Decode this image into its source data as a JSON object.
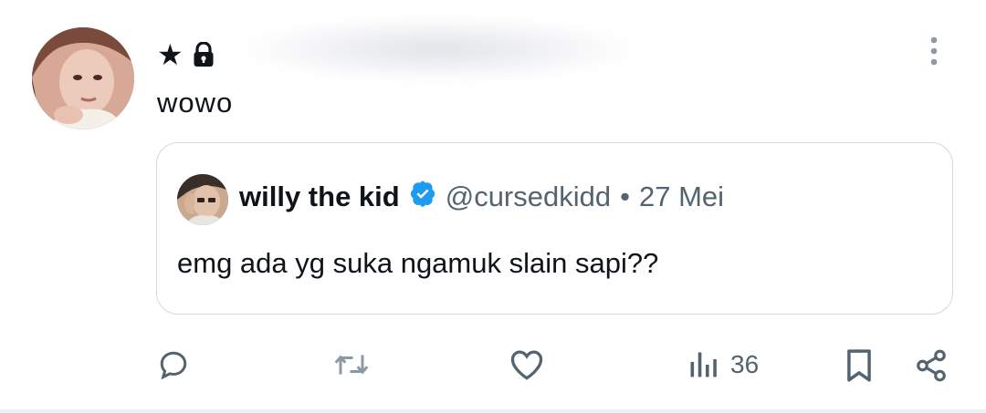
{
  "post": {
    "author_symbol": "★",
    "text": "wowo"
  },
  "quote": {
    "name": "willy the kid",
    "handle": "@cursedkidd",
    "separator": "•",
    "date": "27 Mei",
    "text": "emg ada yg suka ngamuk slain sapi??"
  },
  "actions": {
    "views_count": "36"
  },
  "colors": {
    "text": "#0f1419",
    "muted": "#536471",
    "verified": "#1d9bf0",
    "border": "#cfd9de"
  }
}
